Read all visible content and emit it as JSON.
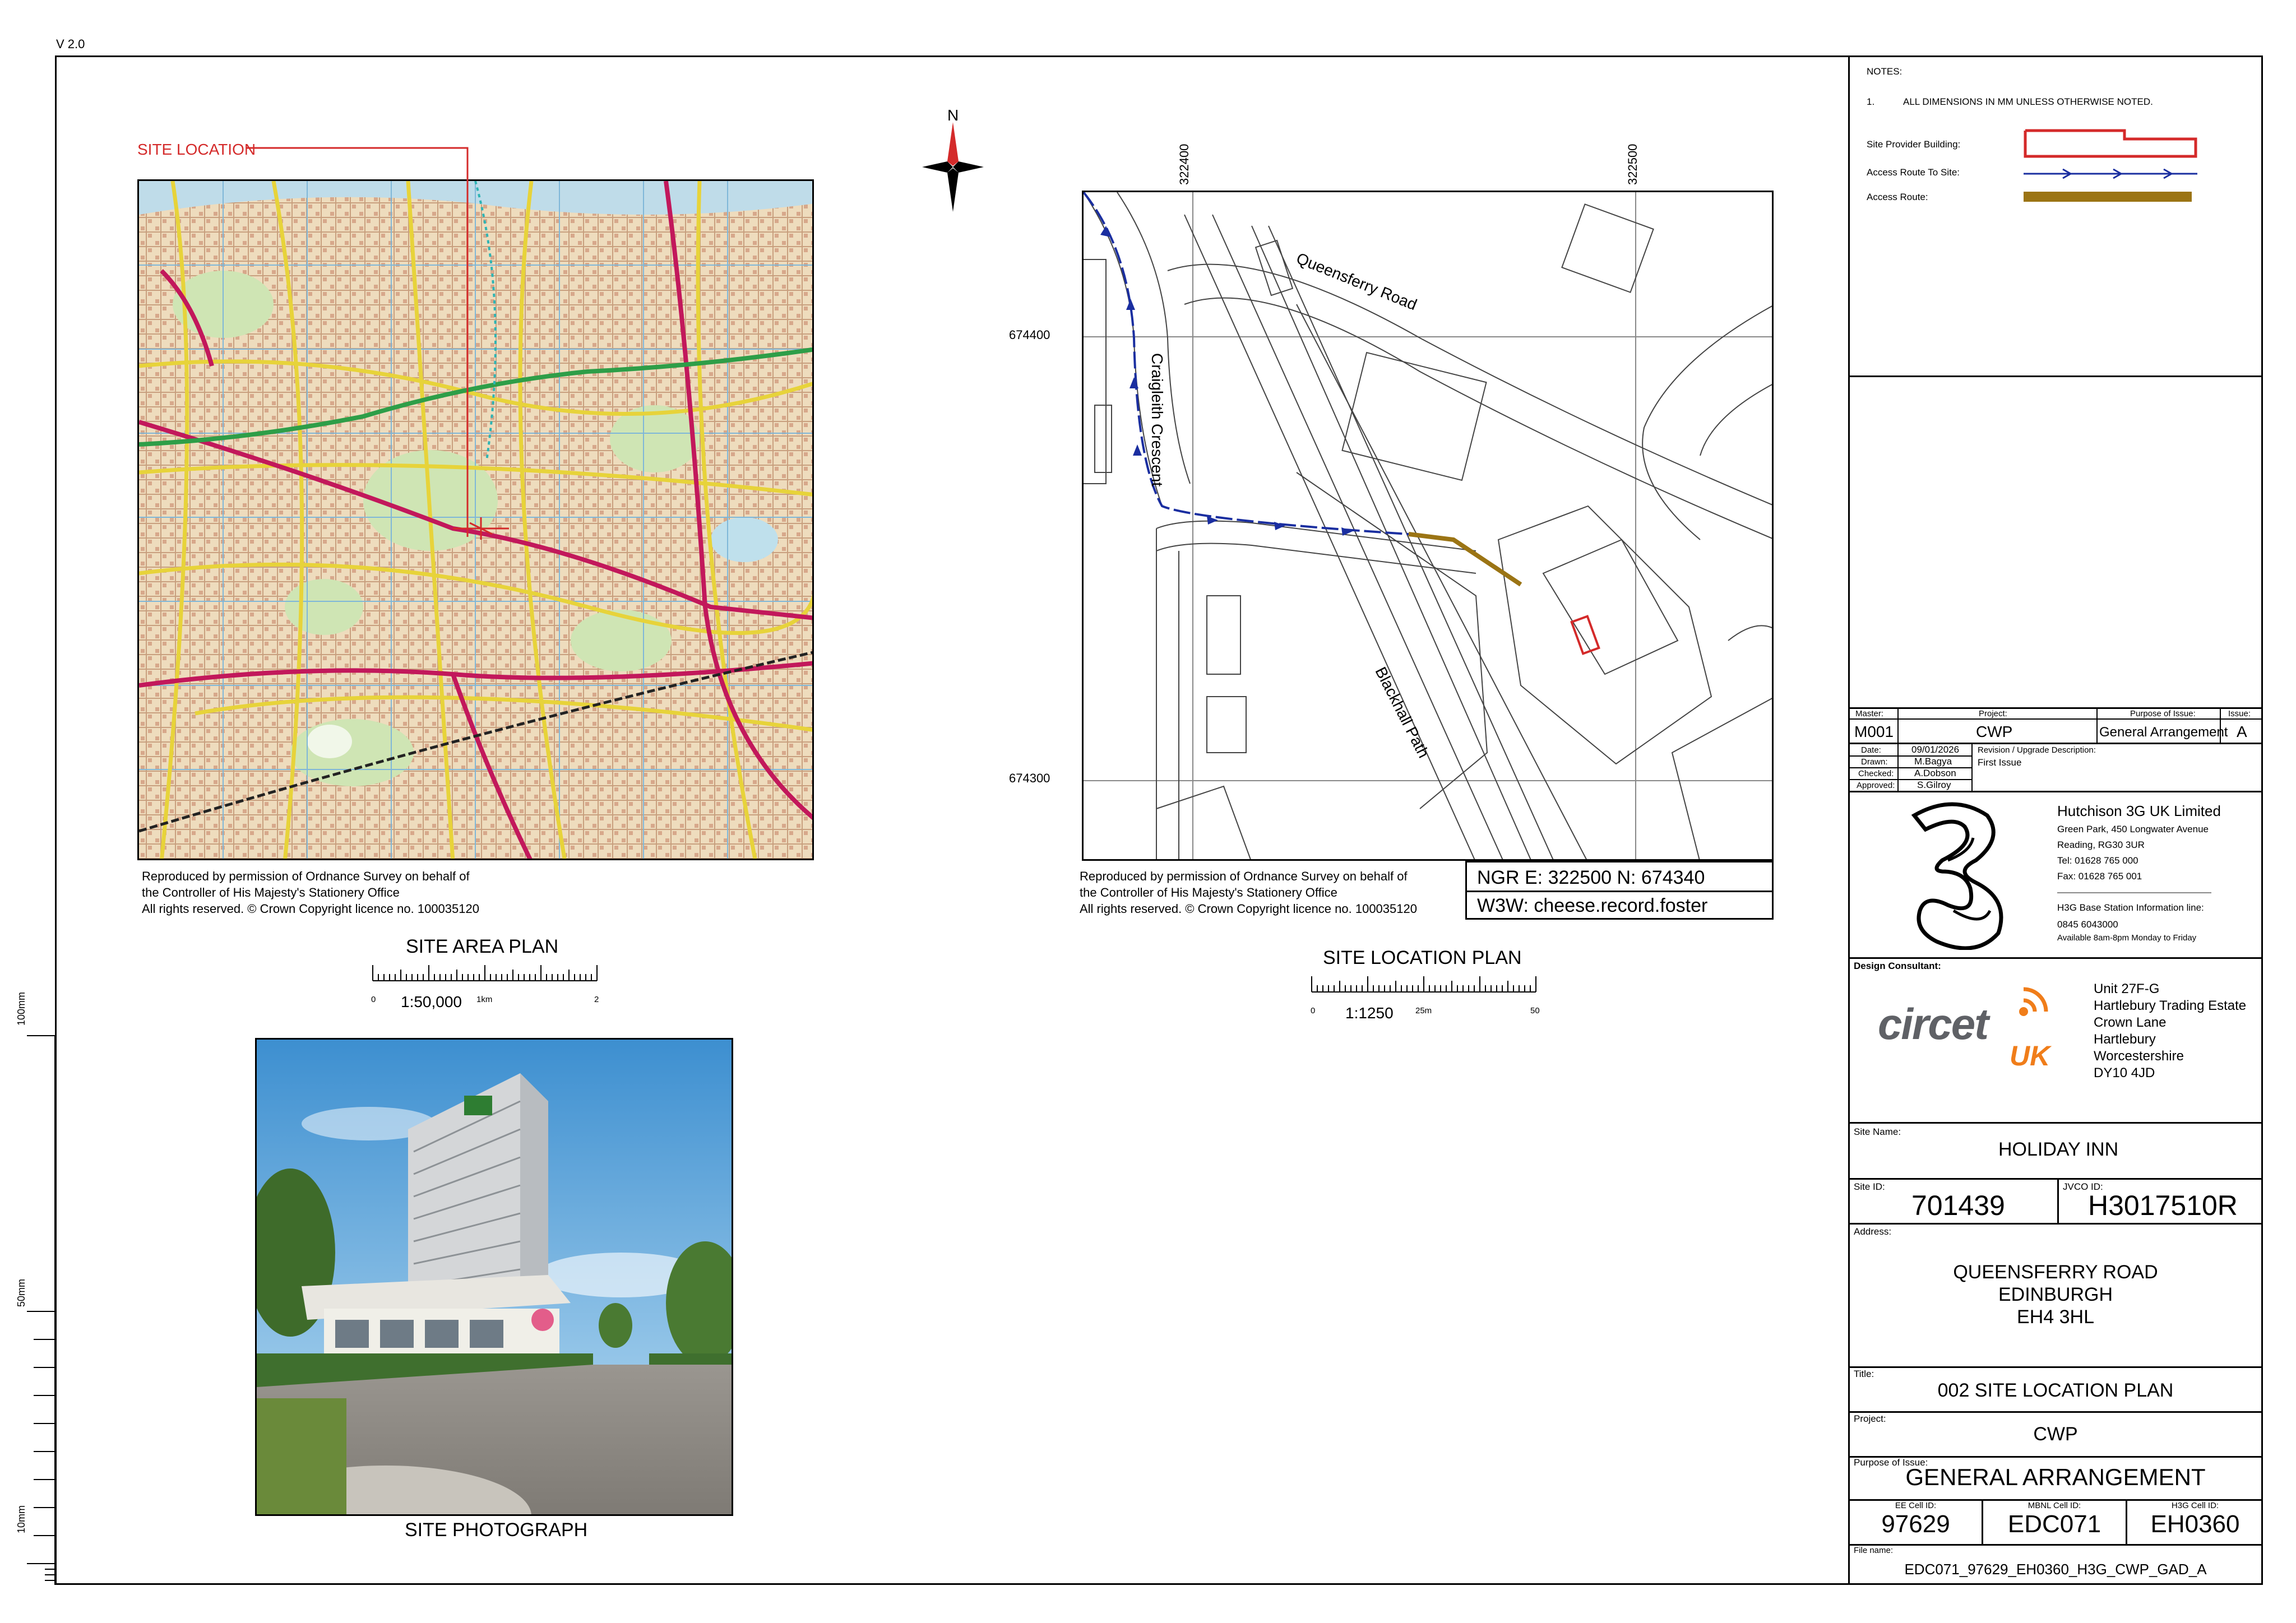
{
  "version": "V 2.0",
  "notes": {
    "heading": "NOTES:",
    "item_number": "1.",
    "item_text": "ALL DIMENSIONS IN MM UNLESS OTHERWISE NOTED."
  },
  "legend": {
    "site_provider_building": "Site Provider Building:",
    "access_route_to_site": "Access Route To Site:",
    "access_route": "Access Route:",
    "colors": {
      "building": "#d42a2a",
      "route_to_site": "#1a2ea0",
      "access_route": "#9b7414"
    }
  },
  "site_area_plan": {
    "callout": "SITE LOCATION",
    "copyright": [
      "Reproduced by permission of Ordnance Survey on behalf of",
      "the Controller of His Majesty's Stationery Office",
      "All rights reserved. © Crown Copyright licence no. 100035120"
    ],
    "title": "SITE AREA PLAN",
    "scale": "1:50,000",
    "scale_start": "0",
    "scale_mid": "1km",
    "scale_end": "2"
  },
  "site_location_plan": {
    "north": "N",
    "grid_e1": "322400",
    "grid_e2": "322500",
    "grid_n1": "674400",
    "grid_n2": "674300",
    "road_queensferry": "Queensferry Road",
    "road_craigleith": "Craigleith Crescent",
    "road_blackhall": "Blackhall Path",
    "copyright": [
      "Reproduced by permission of Ordnance Survey on behalf of",
      "the Controller of His Majesty's Stationery Office",
      "All rights reserved. © Crown Copyright licence no. 100035120"
    ],
    "ngr": "NGR  E: 322500  N: 674340",
    "w3w": "W3W: cheese.record.foster",
    "title": "SITE LOCATION PLAN",
    "scale": "1:1250",
    "scale_start": "0",
    "scale_mid": "25m",
    "scale_end": "50"
  },
  "site_photograph": {
    "title": "SITE PHOTOGRAPH"
  },
  "side_ruler": {
    "label_100": "100mm",
    "label_50": "50mm",
    "label_10": "10mm"
  },
  "title_block": {
    "master_label": "Master:",
    "master": "M001",
    "project_label": "Project:",
    "project": "CWP",
    "purpose_label": "Purpose of Issue:",
    "purpose": "General Arrangement",
    "issue_label": "Issue:",
    "issue": "A",
    "date_label": "Date:",
    "date": "09/01/2026",
    "drawn_label": "Drawn:",
    "drawn": "M.Bagya",
    "checked_label": "Checked:",
    "checked": "A.Dobson",
    "approved_label": "Approved:",
    "approved": "S.Gilroy",
    "revision_label": "Revision / Upgrade Description:",
    "revision": "First Issue",
    "client": {
      "name": "Hutchison 3G UK Limited",
      "address": "Green Park, 450 Longwater Avenue",
      "town": "Reading, RG30 3UR",
      "tel": "Tel: 01628 765 000",
      "fax": "Fax: 01628 765 001",
      "info_label": "H3G Base Station Information line:",
      "info_phone": "0845 6043000",
      "info_hours": "Available 8am-8pm Monday to Friday"
    },
    "consultant_label": "Design Consultant:",
    "consultant_logo": "circet",
    "consultant_logo_sub": "UK",
    "consultant_address": [
      "Unit 27F-G",
      "Hartlebury Trading Estate",
      "Crown Lane",
      "Hartlebury",
      "Worcestershire",
      "DY10 4JD"
    ],
    "site_name_label": "Site Name:",
    "site_name": "HOLIDAY INN",
    "site_id_label": "Site ID:",
    "site_id": "701439",
    "jvco_label": "JVCO ID:",
    "jvco_id": "H3017510R",
    "address_label": "Address:",
    "address": [
      "QUEENSFERRY ROAD",
      "EDINBURGH",
      "EH4 3HL"
    ],
    "title_label": "Title:",
    "title": "002 SITE LOCATION PLAN",
    "project2_label": "Project:",
    "project2": "CWP",
    "purpose2_label": "Purpose of Issue:",
    "purpose2": "GENERAL ARRANGEMENT",
    "ee_label": "EE Cell ID:",
    "ee": "97629",
    "mbnl_label": "MBNL Cell ID:",
    "mbnl": "EDC071",
    "h3g_label": "H3G Cell ID:",
    "h3g": "EH0360",
    "file_label": "File name:",
    "file": "EDC071_97629_EH0360_H3G_CWP_GAD_A"
  }
}
